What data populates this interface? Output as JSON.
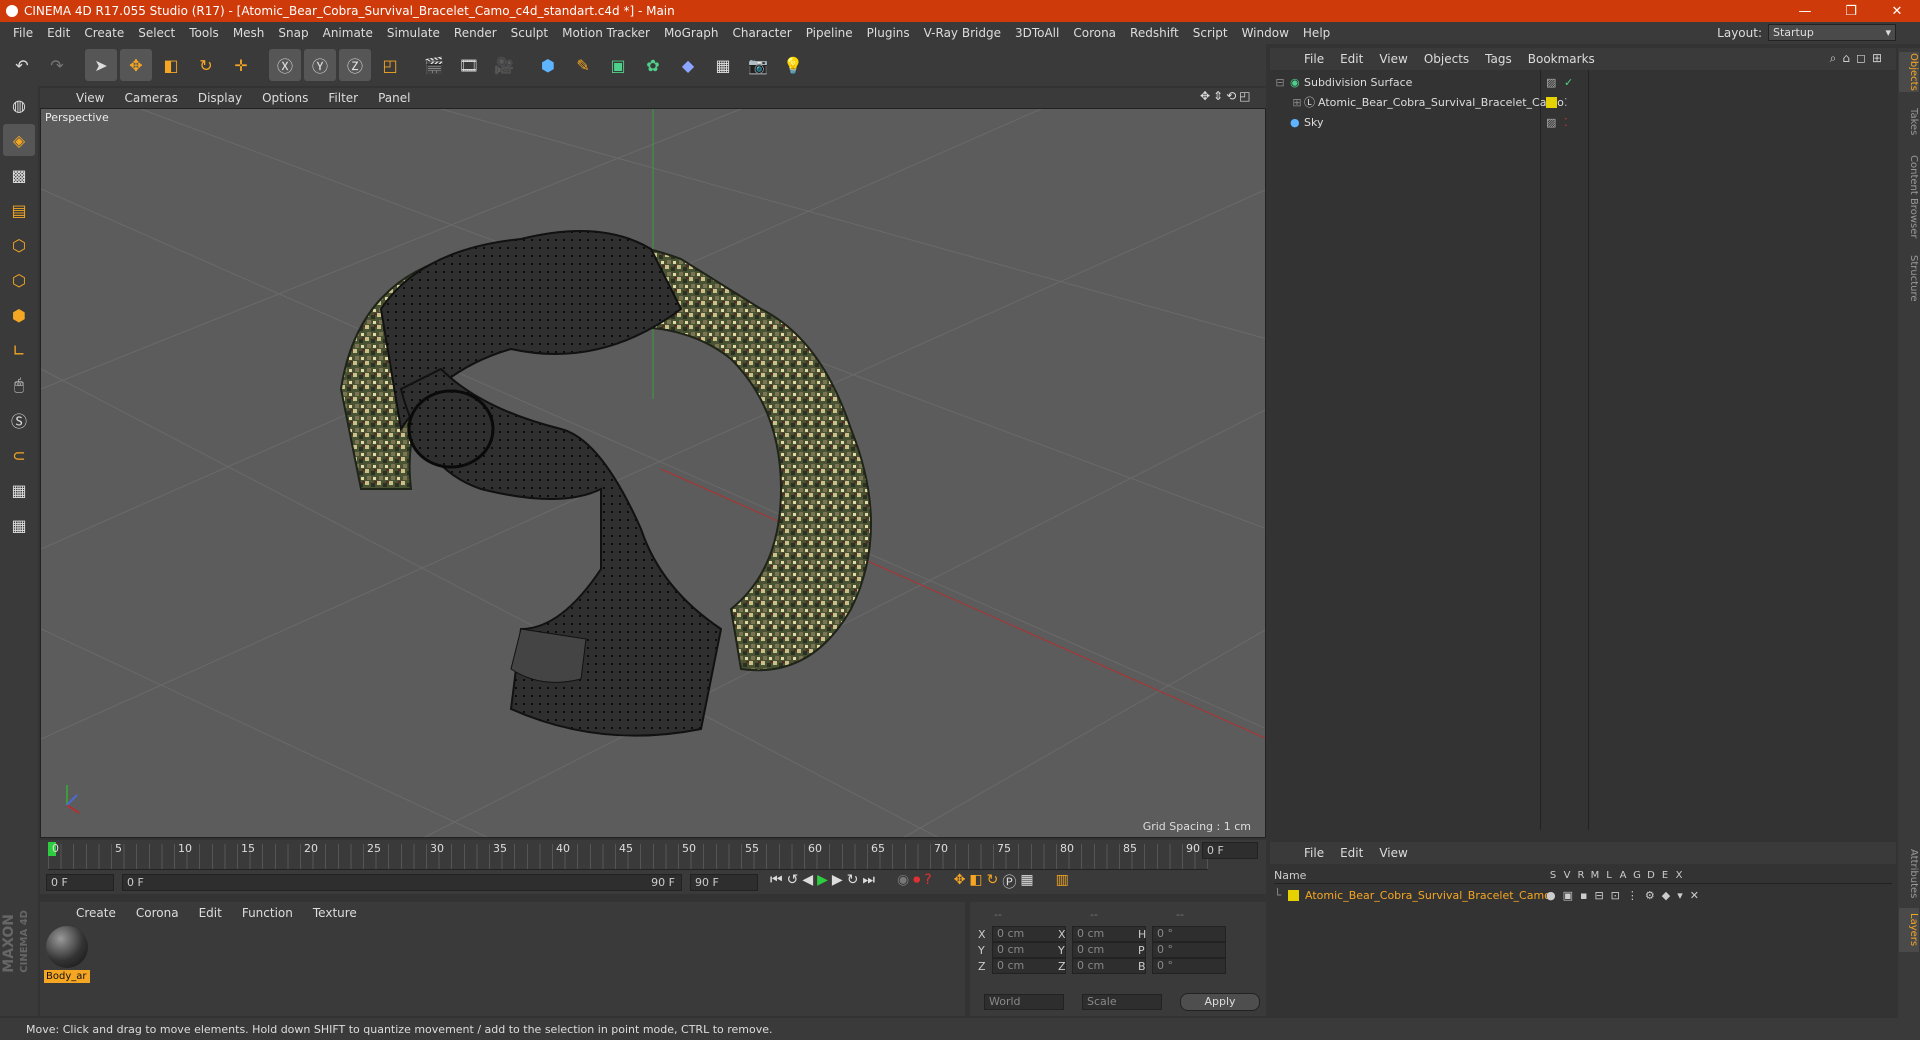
{
  "window": {
    "title": "CINEMA 4D R17.055 Studio (R17) - [Atomic_Bear_Cobra_Survival_Bracelet_Camo_c4d_standart.c4d *] - Main",
    "min": "—",
    "max": "❐",
    "close": "✕"
  },
  "menubar": [
    "File",
    "Edit",
    "Create",
    "Select",
    "Tools",
    "Mesh",
    "Snap",
    "Animate",
    "Simulate",
    "Render",
    "Sculpt",
    "Motion Tracker",
    "MoGraph",
    "Character",
    "Pipeline",
    "Plugins",
    "V-Ray Bridge",
    "3DToAll",
    "Corona",
    "Redshift",
    "Script",
    "Window",
    "Help"
  ],
  "layout": {
    "label": "Layout:",
    "value": "Startup"
  },
  "viewport": {
    "menu": [
      "View",
      "Cameras",
      "Display",
      "Options",
      "Filter",
      "Panel"
    ],
    "label": "Perspective",
    "grid_spacing": "Grid Spacing : 1 cm"
  },
  "timeline": {
    "ticks": [
      "0",
      "5",
      "10",
      "15",
      "20",
      "25",
      "30",
      "35",
      "40",
      "45",
      "50",
      "55",
      "60",
      "65",
      "70",
      "75",
      "80",
      "85",
      "90"
    ],
    "current_frame": "0 F",
    "start": "0 F",
    "range_start": "0 F",
    "range_end": "90 F",
    "end": "90 F"
  },
  "material_manager": {
    "menu": [
      "Create",
      "Corona",
      "Edit",
      "Function",
      "Texture"
    ],
    "material_name": "Body_ar"
  },
  "attributes": {
    "headers": [
      "--",
      "--",
      "--"
    ],
    "rows": [
      {
        "a": "X",
        "av": "0 cm",
        "b": "X",
        "bv": "0 cm",
        "c": "H",
        "cv": "0 °"
      },
      {
        "a": "Y",
        "av": "0 cm",
        "b": "Y",
        "bv": "0 cm",
        "c": "P",
        "cv": "0 °"
      },
      {
        "a": "Z",
        "av": "0 cm",
        "b": "Z",
        "bv": "0 cm",
        "c": "B",
        "cv": "0 °"
      }
    ],
    "world": "World",
    "scale": "Scale",
    "apply": "Apply"
  },
  "object_manager": {
    "menu": [
      "File",
      "Edit",
      "View",
      "Objects",
      "Tags",
      "Bookmarks"
    ],
    "objects": [
      "Subdivision Surface",
      "Atomic_Bear_Cobra_Survival_Bracelet_Camo",
      "Sky"
    ]
  },
  "layer_manager": {
    "menu": [
      "File",
      "Edit",
      "View"
    ],
    "name_header": "Name",
    "columns": [
      "S",
      "V",
      "R",
      "M",
      "L",
      "A",
      "G",
      "D",
      "E",
      "X"
    ],
    "layer": "Atomic_Bear_Cobra_Survival_Bracelet_Camo"
  },
  "right_tabs": [
    "Objects",
    "Takes",
    "Content Browser",
    "Structure"
  ],
  "right_tabs_bottom": [
    "Attributes",
    "Layers"
  ],
  "brand": [
    "MAXON",
    "CINEMA 4D"
  ],
  "status": "Move: Click and drag to move elements. Hold down SHIFT to quantize movement / add to the selection in point mode, CTRL to remove.",
  "colors": {
    "titlebar": "#ce3a09",
    "accent": "#f5a623",
    "layer_yellow": "#e6d200"
  }
}
